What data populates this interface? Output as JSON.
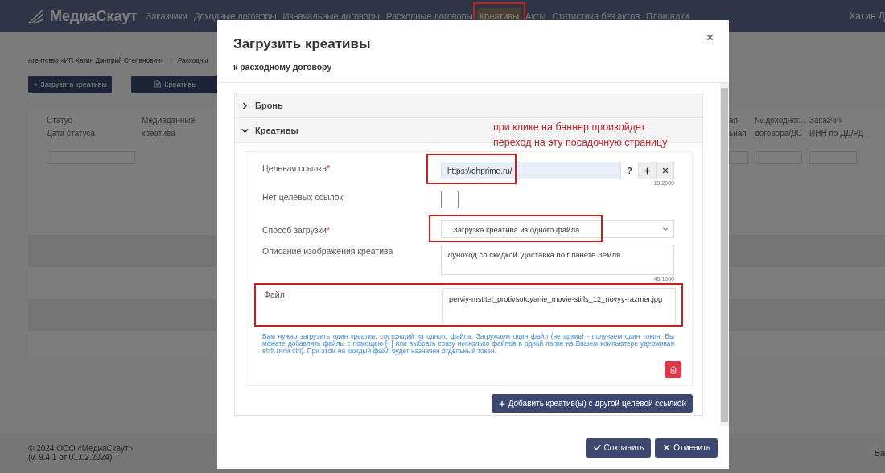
{
  "nav": {
    "brand": "МедиаСкаут",
    "items": [
      {
        "label": "Заказчики",
        "selected": false,
        "annotated": false
      },
      {
        "label": "Доходные договоры",
        "selected": false,
        "annotated": false
      },
      {
        "label": "Изначальные договоры",
        "selected": false,
        "annotated": false
      },
      {
        "label": "Расходные договоры",
        "selected": false,
        "annotated": false
      },
      {
        "label": "Креативы",
        "selected": true,
        "annotated": true
      },
      {
        "label": "Акты",
        "selected": false,
        "annotated": false
      },
      {
        "label": "Статистика без актов",
        "selected": false,
        "annotated": false
      },
      {
        "label": "Площадки",
        "selected": false,
        "annotated": false
      }
    ],
    "user": "Хатин Д"
  },
  "breadcrumb": [
    "Агентство «ИП Хатин Дмитрий Степанович»",
    "Расходны"
  ],
  "toolbar": [
    {
      "label": "Загрузить креативы",
      "kind": "add"
    },
    {
      "label": "Креативы",
      "kind": "file"
    }
  ],
  "table": {
    "columns": [
      {
        "lines": [
          "Статус",
          "Дата статуса"
        ],
        "filter": true
      },
      {
        "lines": [
          "Медиаданные",
          "креатива"
        ],
        "filter": false
      },
      {
        "lines": [
          "ая",
          "ьная"
        ],
        "filter": true
      },
      {
        "lines": [
          "№ доходног...",
          "договора/ДС"
        ],
        "filter": true
      },
      {
        "lines": [
          "Заказчик",
          "ИНН по ДД/РД"
        ],
        "filter": true
      }
    ]
  },
  "footer": {
    "copyright": "© 2024 ООО «МедиаСкаут»",
    "version": "(v. 9.4.1 от 01.02.2024)",
    "right": "Ба"
  },
  "modal": {
    "title": "Загрузить креативы",
    "subtitle": "к расходному договору",
    "sections": [
      {
        "label": "Бронь",
        "expanded": false
      },
      {
        "label": "Креативы",
        "expanded": true
      }
    ],
    "note": "при клике на баннер произойдет переход на эту посадочную страницу",
    "fields": [
      {
        "kind": "url",
        "label": "Целевая ссылка",
        "mark": "*",
        "value": "https://dhprime.ru/",
        "counter": "19/2000",
        "help": "?",
        "annotated": true
      },
      {
        "kind": "checkbox",
        "label": "Нет целевых ссылок",
        "checked": false,
        "annotated": false
      },
      {
        "kind": "select",
        "label": "Способ загрузки",
        "mark": "*",
        "value": "Загрузка креатива из одного файла",
        "annotated": true
      },
      {
        "kind": "textarea",
        "label": "Описание изображения креатива",
        "value": "Луноход со скидкой. Доставка по планете Земля",
        "counter": "45/1000",
        "annotated": false
      },
      {
        "kind": "file",
        "label": "Файл",
        "value": "perviy-mstitel_protivsotoyanie_movie-stills_12_novyy-razmer.jpg",
        "annotated": true
      }
    ],
    "hint": "Вам нужно загрузить один креатив, состоящий из одного файла. Загружаем один файл (не архив) - получаем один токен. Вы можете добавлять файлы с помощью [+] или выбрать сразу несколько файлов в одной папке на Вашем компьютере удерживая shift (или ctrl). При этом на каждый файл будет назначен отдельный токен.",
    "add_button": "Добавить креатив(ы) с другой целевой ссылкой",
    "buttons": [
      {
        "label": "Сохранить",
        "kind": "save"
      },
      {
        "label": "Отменить",
        "kind": "cancel"
      }
    ]
  }
}
